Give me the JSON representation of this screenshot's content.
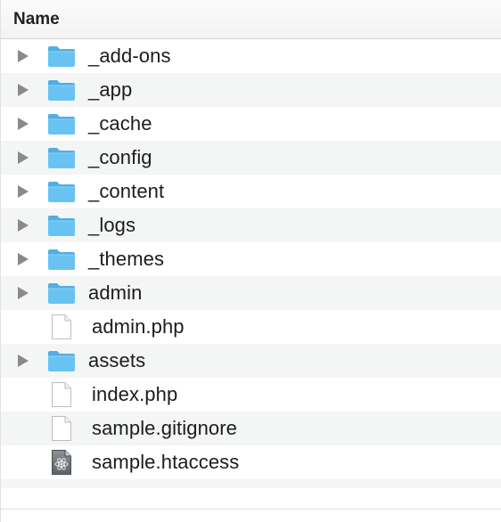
{
  "header": {
    "name_label": "Name"
  },
  "files": [
    {
      "name": "_add-ons",
      "kind": "folder",
      "expandable": true,
      "icon": "folder-icon"
    },
    {
      "name": "_app",
      "kind": "folder",
      "expandable": true,
      "icon": "folder-icon"
    },
    {
      "name": "_cache",
      "kind": "folder",
      "expandable": true,
      "icon": "folder-icon"
    },
    {
      "name": "_config",
      "kind": "folder",
      "expandable": true,
      "icon": "folder-icon"
    },
    {
      "name": "_content",
      "kind": "folder",
      "expandable": true,
      "icon": "folder-icon"
    },
    {
      "name": "_logs",
      "kind": "folder",
      "expandable": true,
      "icon": "folder-icon"
    },
    {
      "name": "_themes",
      "kind": "folder",
      "expandable": true,
      "icon": "folder-icon"
    },
    {
      "name": "admin",
      "kind": "folder",
      "expandable": true,
      "icon": "folder-icon"
    },
    {
      "name": "admin.php",
      "kind": "document",
      "expandable": false,
      "icon": "document-icon"
    },
    {
      "name": "assets",
      "kind": "folder",
      "expandable": true,
      "icon": "folder-icon"
    },
    {
      "name": "index.php",
      "kind": "document",
      "expandable": false,
      "icon": "document-icon"
    },
    {
      "name": "sample.gitignore",
      "kind": "document",
      "expandable": false,
      "icon": "document-icon"
    },
    {
      "name": "sample.htaccess",
      "kind": "executable",
      "expandable": false,
      "icon": "atom-document-icon"
    }
  ],
  "colors": {
    "folder_front": "#68c3f2",
    "folder_back": "#52aee2",
    "alt_row": "#f4f5f5",
    "disclosure": "#8a8a8a"
  }
}
